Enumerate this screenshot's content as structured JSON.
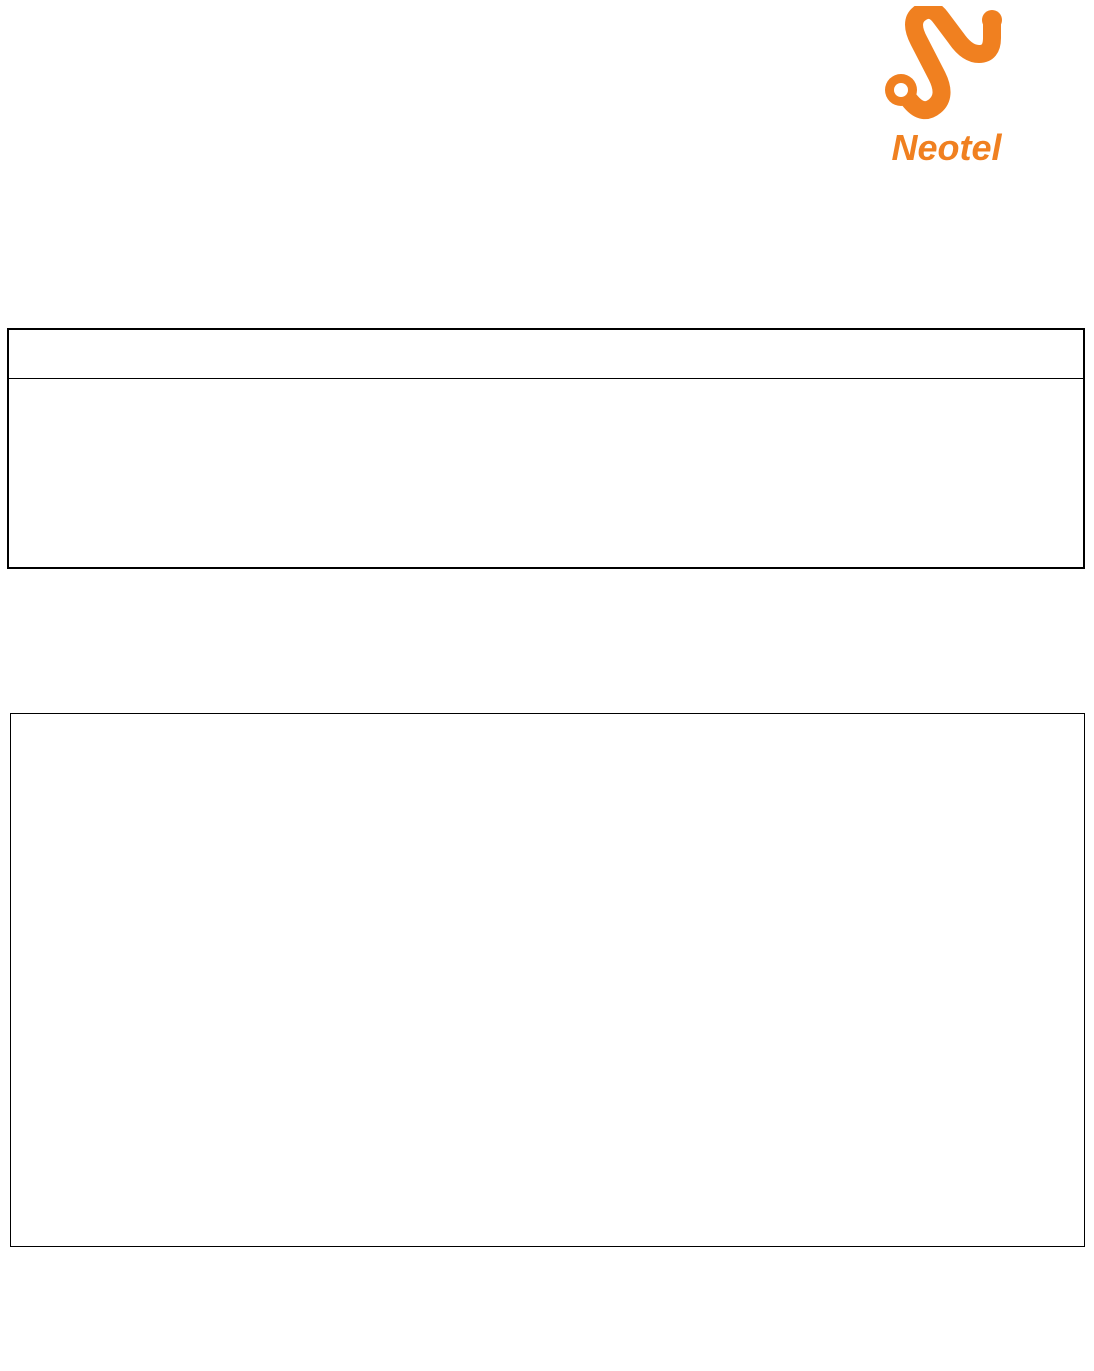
{
  "logo": {
    "brand_name": "Neotel",
    "color": "#f08020"
  }
}
